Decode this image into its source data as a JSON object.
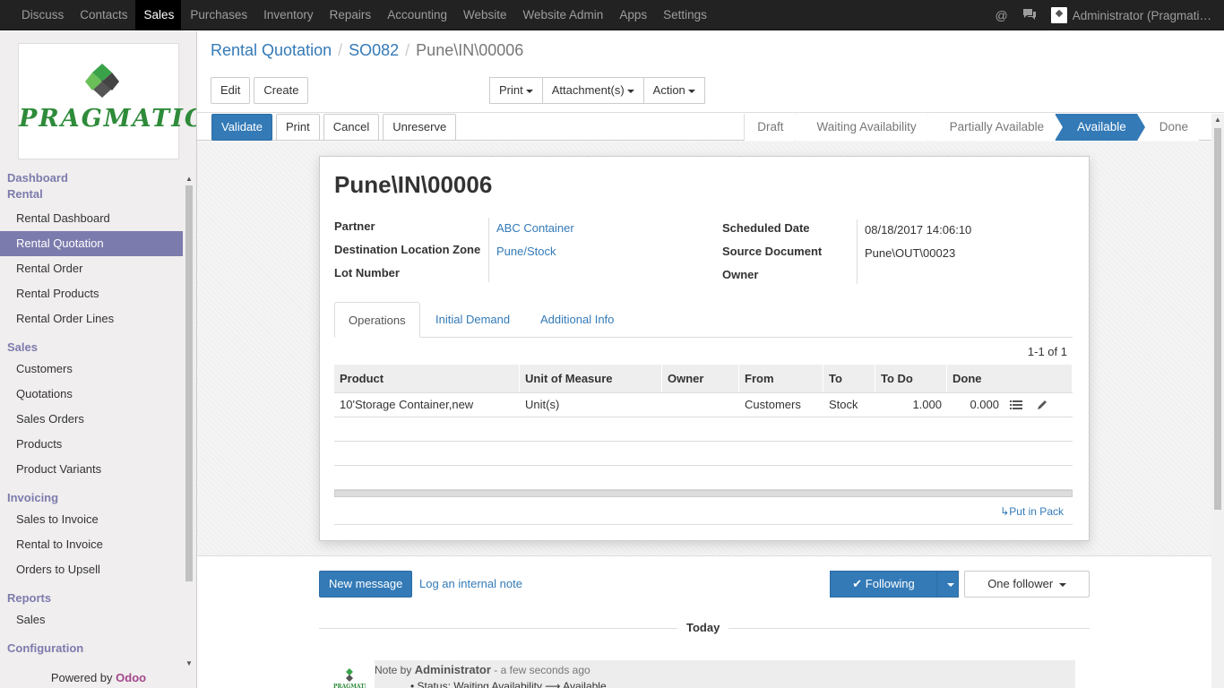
{
  "topbar": {
    "menu": [
      "Discuss",
      "Contacts",
      "Sales",
      "Purchases",
      "Inventory",
      "Repairs",
      "Accounting",
      "Website",
      "Website Admin",
      "Apps",
      "Settings"
    ],
    "active": "Sales",
    "user": "Administrator (Pragmati…"
  },
  "sidebar": {
    "logo_text": "PRAGMATIC",
    "dashboard": "Dashboard",
    "rental": "Rental",
    "rental_items": [
      "Rental Dashboard",
      "Rental Quotation",
      "Rental Order",
      "Rental Products",
      "Rental Order Lines"
    ],
    "sales": "Sales",
    "sales_items": [
      "Customers",
      "Quotations",
      "Sales Orders",
      "Products",
      "Product Variants"
    ],
    "invoicing": "Invoicing",
    "invoicing_items": [
      "Sales to Invoice",
      "Rental to Invoice",
      "Orders to Upsell"
    ],
    "reports": "Reports",
    "reports_items": [
      "Sales"
    ],
    "configuration": "Configuration",
    "powered_by": "Powered by",
    "odoo": "Odoo"
  },
  "breadcrumb": {
    "first": "Rental Quotation",
    "second": "SO082",
    "current": "Pune\\IN\\00006"
  },
  "control": {
    "edit": "Edit",
    "create": "Create",
    "print": "Print",
    "attachments": "Attachment(s)",
    "action": "Action"
  },
  "header": {
    "validate": "Validate",
    "print": "Print",
    "cancel": "Cancel",
    "unreserve": "Unreserve",
    "states": [
      "Draft",
      "Waiting Availability",
      "Partially Available",
      "Available",
      "Done"
    ],
    "active_state": "Available"
  },
  "form": {
    "title": "Pune\\IN\\00006",
    "partner_label": "Partner",
    "partner": "ABC Container",
    "dest_label": "Destination Location Zone",
    "dest": "Pune/Stock",
    "lot_label": "Lot Number",
    "sched_label": "Scheduled Date",
    "sched": "08/18/2017 14:06:10",
    "source_label": "Source Document",
    "source": "Pune\\OUT\\00023",
    "owner_label": "Owner"
  },
  "tabs": [
    "Operations",
    "Initial Demand",
    "Additional Info"
  ],
  "pager": "1-1 of 1",
  "operations": {
    "columns": [
      "Product",
      "Unit of Measure",
      "Owner",
      "From",
      "To",
      "To Do",
      "Done"
    ],
    "rows": [
      {
        "product": "10'Storage Container,new",
        "uom": "Unit(s)",
        "owner": "",
        "from": "Customers",
        "to": "Stock",
        "todo": "1.000",
        "done": "0.000"
      }
    ],
    "put_in_pack": "↳Put in Pack"
  },
  "chatter": {
    "new_message": "New message",
    "log_note": "Log an internal note",
    "following": "✔ Following",
    "followers": "One follower",
    "today": "Today",
    "note_prefix": "Note by",
    "note_author": "Administrator",
    "note_time": "- a few seconds ago",
    "tracking": "Status: Waiting Availability ⟶ Available"
  }
}
